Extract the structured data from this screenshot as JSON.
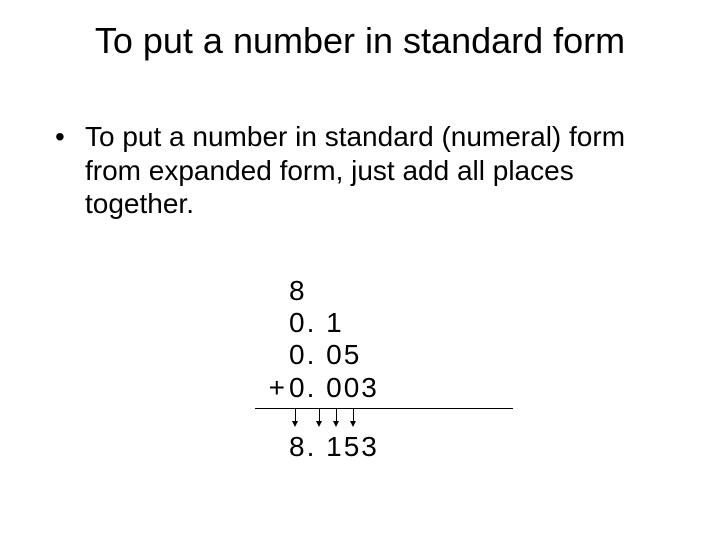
{
  "title": "To put a number in standard form",
  "bullet": {
    "marker": "•",
    "text": "To put a number in standard (numeral) form from expanded form, just add all places together."
  },
  "addition": {
    "addends": [
      "8",
      "0. 1",
      "0. 05",
      "0. 003"
    ],
    "operator": "+",
    "result": "8. 153"
  }
}
